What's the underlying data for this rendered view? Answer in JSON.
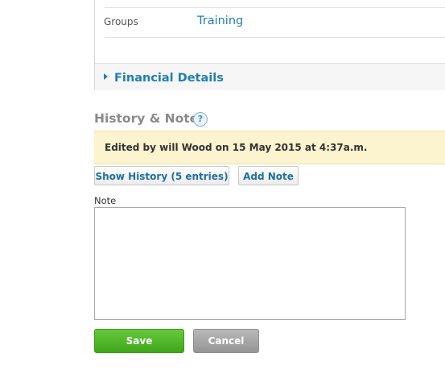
{
  "details": {
    "groups_label": "Groups",
    "groups_value": "Training",
    "financial_details_label": "Financial Details"
  },
  "history": {
    "title": "History & Notes",
    "help_glyph": "?",
    "edited_text": "Edited by will Wood on 15 May 2015 at 4:37a.m.",
    "show_history_label": "Show History (5 entries)",
    "add_note_label": "Add Note"
  },
  "note": {
    "label": "Note",
    "value": ""
  },
  "actions": {
    "save_label": "Save",
    "cancel_label": "Cancel"
  },
  "colors": {
    "link": "#1f7fb4",
    "save": "#4cb327",
    "cancel": "#a3a3a3",
    "banner": "#fcf3cf"
  }
}
